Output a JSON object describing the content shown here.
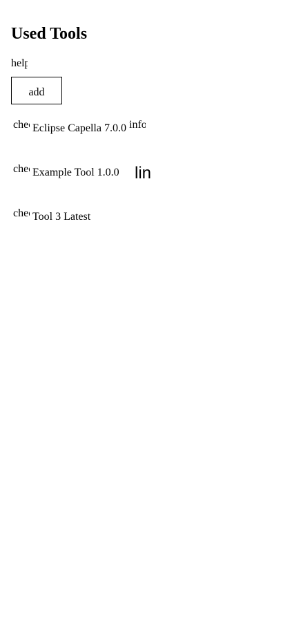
{
  "header": {
    "title": "Used Tools",
    "help_icon_text": "help"
  },
  "toolbar": {
    "add_label": "add"
  },
  "tools": [
    {
      "check_icon_text": "check",
      "name": "Eclipse Capella 7.0.0",
      "info_icon_text": "info"
    },
    {
      "check_icon_text": "check",
      "name": "Example Tool 1.0.0",
      "link_icon_text": "link"
    },
    {
      "check_icon_text": "check",
      "name": "Tool 3 Latest"
    }
  ],
  "icons": {
    "help": "help-icon",
    "check": "check-icon",
    "info": "info-icon",
    "link": "link-icon"
  }
}
